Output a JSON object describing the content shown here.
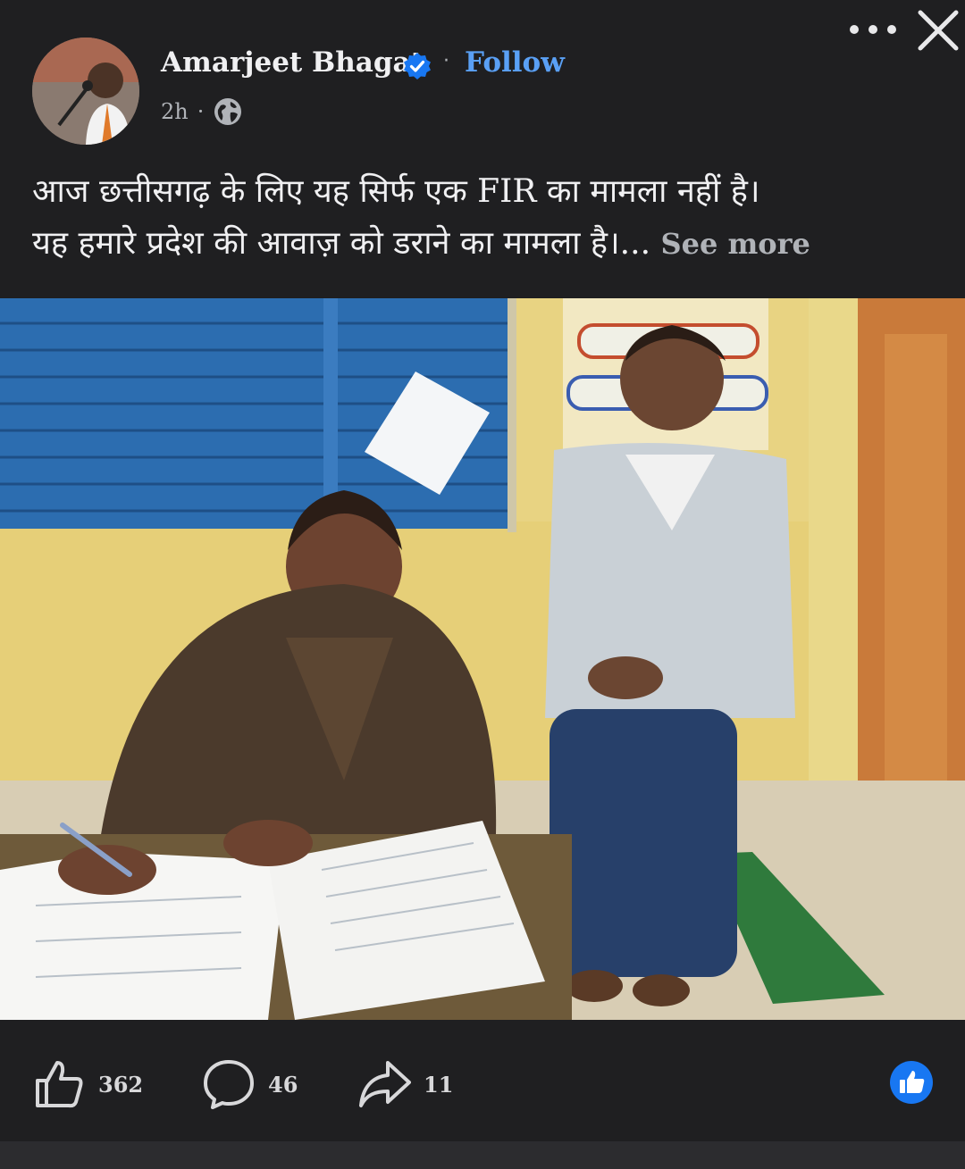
{
  "post": {
    "author": "Amarjeet Bhagat",
    "follow_label": "Follow",
    "time": "2h",
    "caption_line1": "आज छत्तीसगढ़ के लिए यह सिर्फ एक FIR का मामला नहीं है।",
    "caption_line2": "यह हमारे प्रदेश की आवाज़ को डराने का मामला है।...",
    "see_more": "See more"
  },
  "reactions": {
    "likes": "362",
    "comments": "46",
    "shares": "11"
  },
  "icons": {
    "verified": "verified-badge-icon",
    "audience": "globe-icon",
    "more": "more-options-icon",
    "close": "close-icon",
    "like": "thumbs-up-icon",
    "comment": "comment-icon",
    "share": "share-icon"
  },
  "colors": {
    "background": "#1f1f21",
    "accent": "#1877f2",
    "follow": "#5aa0f5"
  }
}
